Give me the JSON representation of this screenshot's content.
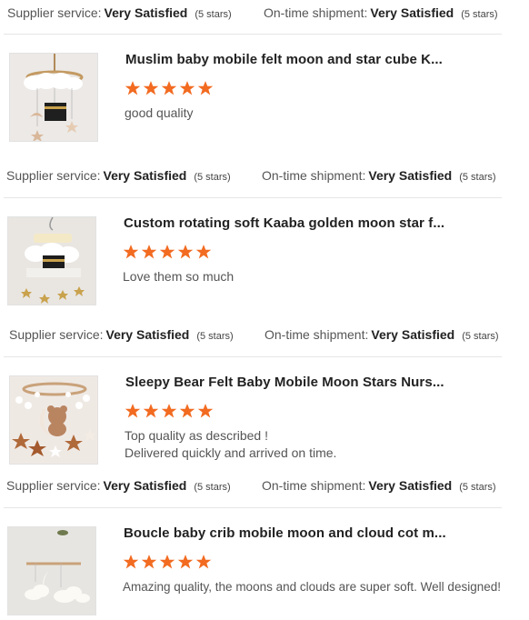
{
  "labels": {
    "supplier": "Supplier service:",
    "shipment": "On-time shipment:"
  },
  "meta_rows": [
    {
      "supplier_value": "Very Satisfied",
      "supplier_stars": "(5 stars)",
      "shipment_value": "Very Satisfied",
      "shipment_stars": "(5 stars)"
    },
    {
      "supplier_value": "Very Satisfied",
      "supplier_stars": "(5 stars)",
      "shipment_value": "Very Satisfied",
      "shipment_stars": "(5 stars)"
    },
    {
      "supplier_value": "Very Satisfied",
      "supplier_stars": "(5 stars)",
      "shipment_value": "Very Satisfied",
      "shipment_stars": "(5 stars)"
    },
    {
      "supplier_value": "Very Satisfied",
      "supplier_stars": "(5 stars)",
      "shipment_value": "Very Satisfied",
      "shipment_stars": "(5 stars)"
    }
  ],
  "reviews": [
    {
      "title": "Muslim baby mobile felt moon and star cube K...",
      "rating": 5,
      "comment_lines": [
        "good quality"
      ],
      "thumbnail_icon": "baby-mobile-kaaba-cube-image"
    },
    {
      "title": "Custom rotating soft Kaaba golden moon star f...",
      "rating": 5,
      "comment_lines": [
        "Love them so much"
      ],
      "thumbnail_icon": "rotating-kaaba-mobile-image"
    },
    {
      "title": "Sleepy Bear Felt Baby Mobile Moon Stars Nurs...",
      "rating": 5,
      "comment_lines": [
        "Top quality as described !",
        "Delivered quickly and arrived on time."
      ],
      "thumbnail_icon": "sleepy-bear-mobile-image"
    },
    {
      "title": "Boucle baby crib mobile moon and cloud cot m...",
      "rating": 5,
      "comment_lines": [
        "Amazing quality, the moons and clouds are super soft. Well designed!"
      ],
      "thumbnail_icon": "boucle-moon-cloud-mobile-image"
    }
  ],
  "colors": {
    "star": "#f26b21",
    "divider": "#e6e6e6",
    "title_text": "#222222"
  }
}
